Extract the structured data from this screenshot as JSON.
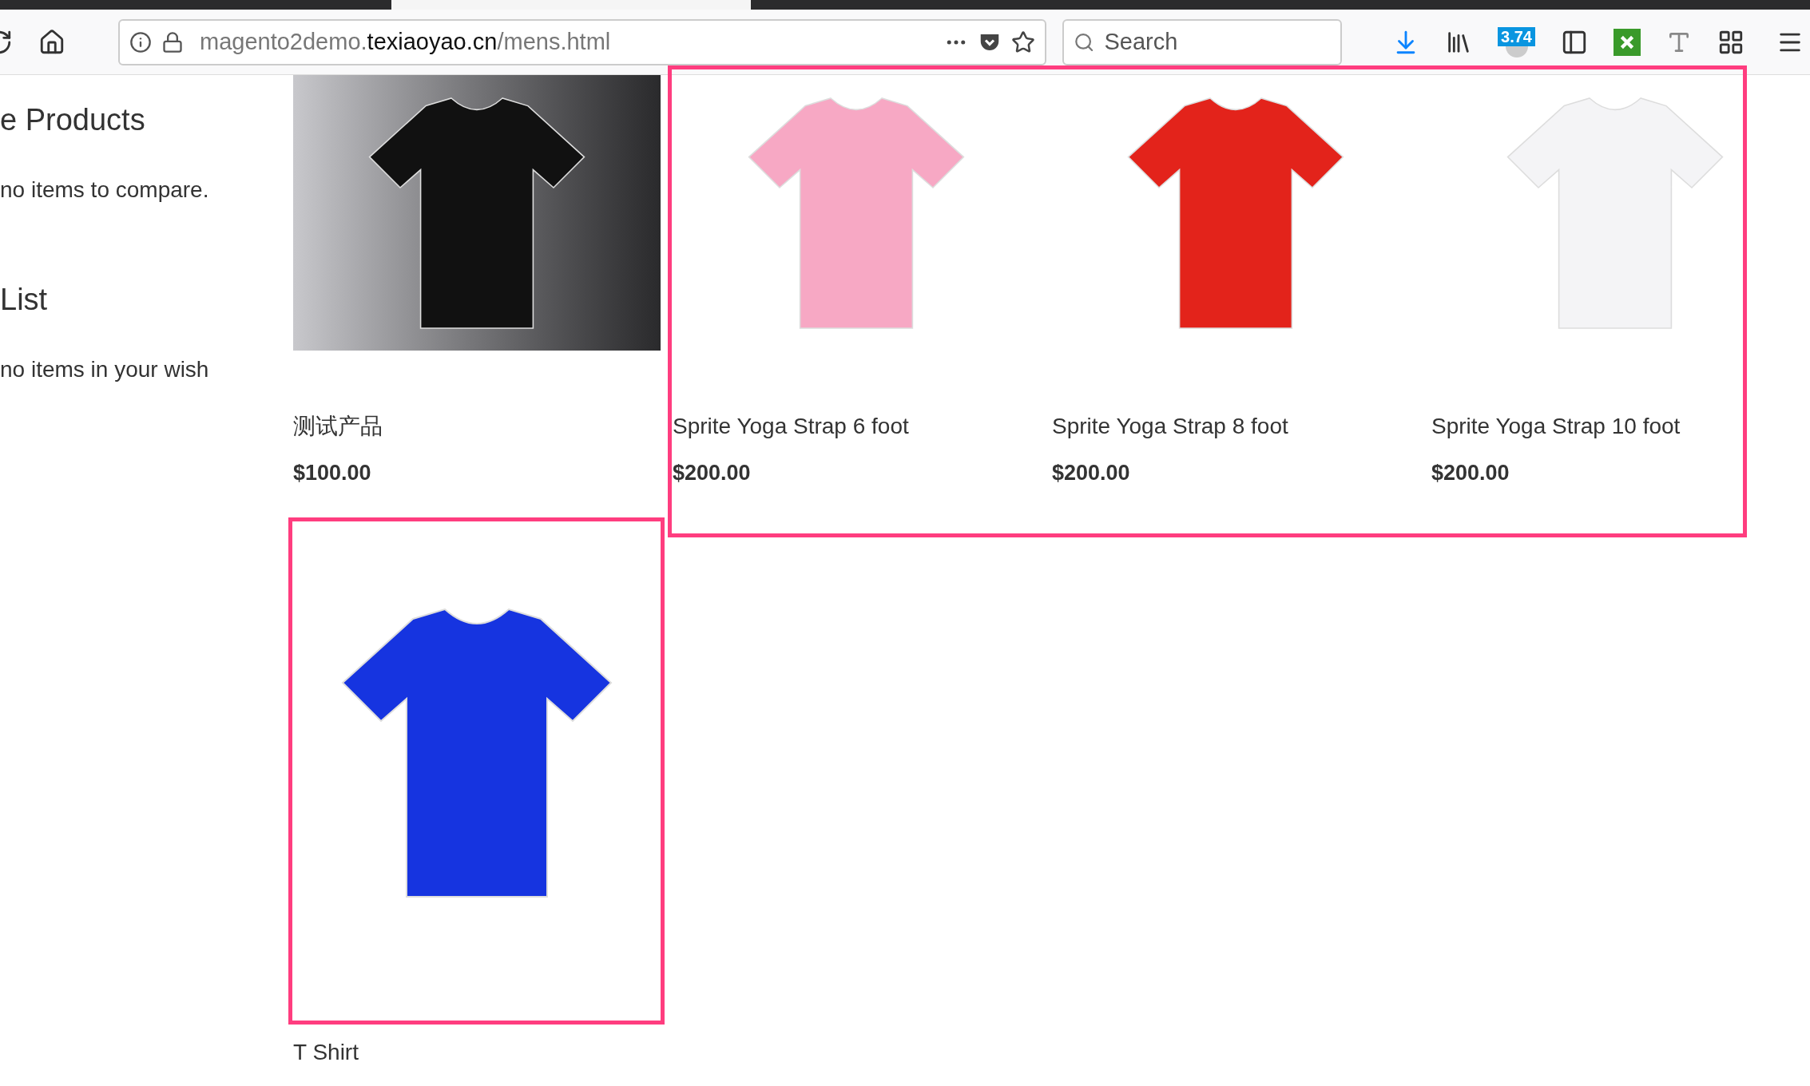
{
  "browser": {
    "url": {
      "prefix": "magento2demo.",
      "domain": "texiaoyao.cn",
      "path": "/mens.html"
    },
    "search": {
      "placeholder": "Search"
    },
    "extension_badge": "3.74"
  },
  "sidebar": [
    {
      "heading": "e Products",
      "text": "no items to compare."
    },
    {
      "heading": "List",
      "text": "no items in your wish"
    }
  ],
  "product_rows": [
    {
      "groups": [
        {
          "highlighted": false,
          "products": [
            {
              "name": "测试产品",
              "price": "$100.00",
              "color": "#111111"
            }
          ]
        },
        {
          "highlighted": true,
          "products": [
            {
              "name": "Sprite Yoga Strap 6 foot",
              "price": "$200.00",
              "color": "#f7a8c4"
            },
            {
              "name": "Sprite Yoga Strap 8 foot",
              "price": "$200.00",
              "color": "#e3231b"
            },
            {
              "name": "Sprite Yoga Strap 10 foot",
              "price": "$200.00",
              "color": "#f4f4f6"
            }
          ]
        }
      ]
    },
    {
      "groups": [
        {
          "highlighted": true,
          "products": [
            {
              "name": "T Shirt",
              "color": "#1634e0"
            }
          ]
        }
      ]
    }
  ]
}
